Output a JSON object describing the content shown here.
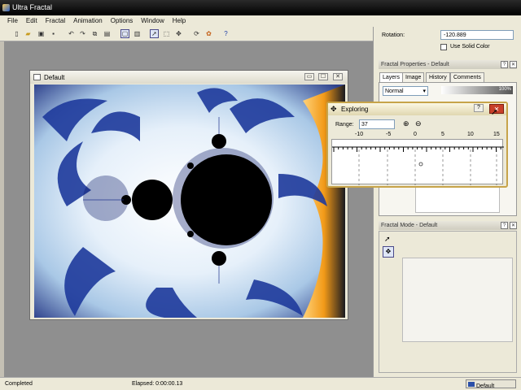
{
  "app": {
    "title": "Ultra Fractal"
  },
  "menu": [
    "File",
    "Edit",
    "Fractal",
    "Animation",
    "Options",
    "Window",
    "Help"
  ],
  "icons": {
    "toolbar": [
      "new-icon",
      "open-icon",
      "save-all-icon",
      "save-icon",
      "undo-icon",
      "redo-icon",
      "copy-icon",
      "paste-icon",
      "layout-icon",
      "panel-icon",
      "select-arrow-icon",
      "zoom-select-icon",
      "move-icon",
      "rotate-icon",
      "render-icon",
      "palette-icon",
      "help-icon"
    ]
  },
  "document": {
    "title": "Default",
    "min": "▭",
    "max": "☐",
    "close": "✕"
  },
  "status": {
    "left": "Completed",
    "elapsed": "Elapsed: 0:00:00.13",
    "layer": "Default"
  },
  "panel": {
    "rotation_label": "Rotation:",
    "rotation_value": "-120.889",
    "solid_color": "Use Solid Color",
    "props_title": "Fractal Properties - Default",
    "tabs": [
      "Layers",
      "Image",
      "History",
      "Comments"
    ],
    "blend_mode": "Normal",
    "opacity": "100%",
    "mode_title": "Fractal Mode - Default"
  },
  "explorer": {
    "title": "Exploring",
    "range_label": "Range:",
    "range_value": "37",
    "ticks": [
      "-10",
      "-5",
      "0",
      "5",
      "10",
      "15"
    ]
  }
}
